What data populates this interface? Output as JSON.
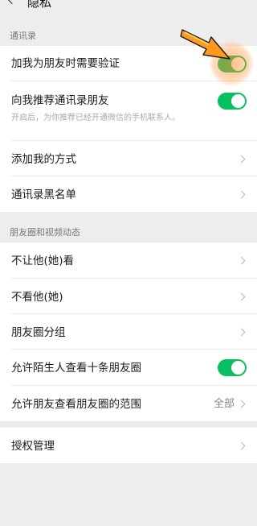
{
  "header": {
    "title": "隐私"
  },
  "sections": {
    "contacts": {
      "title": "通讯录",
      "verify_label": "加我为朋友时需要验证",
      "verify_on": true,
      "recommend_label": "向我推荐通讯录朋友",
      "recommend_desc": "开启后，为你推荐已经开通微信的手机联系人。",
      "recommend_on": true,
      "add_methods_label": "添加我的方式",
      "blacklist_label": "通讯录黑名单"
    },
    "moments": {
      "title": "朋友圈和视频动态",
      "hide_my_posts_label": "不让他(她)看",
      "hide_their_posts_label": "不看他(她)",
      "groups_label": "朋友圈分组",
      "stranger_view_label": "允许陌生人查看十条朋友圈",
      "stranger_view_on": true,
      "visible_range_label": "允许朋友查看朋友圈的范围",
      "visible_range_value": "全部"
    },
    "auth": {
      "manage_label": "授权管理"
    }
  },
  "colors": {
    "toggle_on": "#07c160",
    "highlight": "#ff8c28",
    "background": "#ededed"
  },
  "icons": [
    "back-chevron-icon",
    "chevron-right-icon",
    "pointer-arrow-icon"
  ]
}
